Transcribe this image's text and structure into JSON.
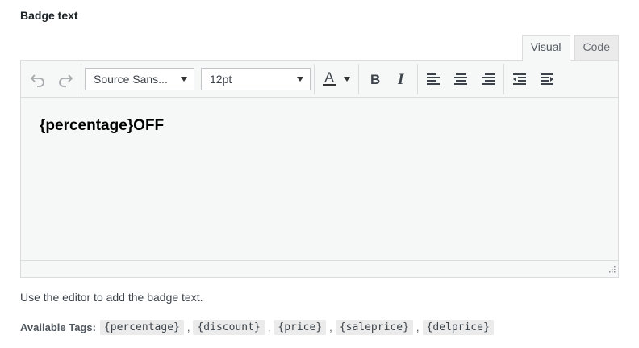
{
  "field": {
    "label": "Badge text"
  },
  "tabs": {
    "visual": "Visual",
    "code": "Code"
  },
  "toolbar": {
    "font_family": "Source Sans...",
    "font_size": "12pt",
    "text_color": "A"
  },
  "editor": {
    "content": "{percentage}OFF"
  },
  "help_text": "Use the editor to add the badge text.",
  "available_tags": {
    "label": "Available Tags:",
    "tags": [
      "{percentage}",
      "{discount}",
      "{price}",
      "{saleprice}",
      "{delprice}"
    ],
    "separator": ","
  },
  "icons": {
    "undo": "undo-icon",
    "redo": "redo-icon",
    "bold": "bold-icon",
    "italic": "italic-icon",
    "align_left": "align-left-icon",
    "align_center": "align-center-icon",
    "align_right": "align-right-icon",
    "outdent": "outdent-icon",
    "indent": "indent-icon"
  },
  "colors": {
    "border": "#dcdcde",
    "background": "#f6f7f7",
    "text_color_underline": "#333333"
  }
}
